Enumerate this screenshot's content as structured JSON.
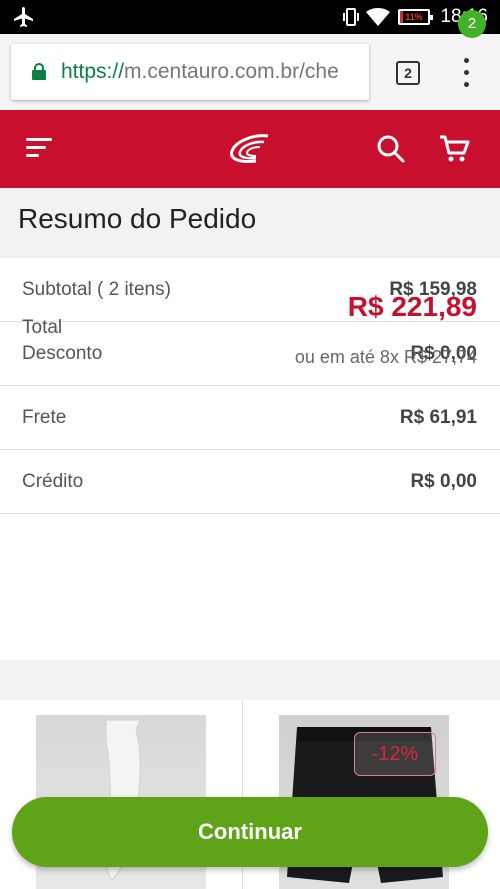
{
  "status_bar": {
    "time": "18:16",
    "battery_text": "11%",
    "battery_level": 0.11,
    "icons": [
      "airplane-icon",
      "vibrate-icon",
      "wifi-icon",
      "battery-icon"
    ]
  },
  "browser": {
    "url_scheme": "https://",
    "url_rest": "m.centauro.com.br/che",
    "tab_count": "2",
    "colors": {
      "secure": "#0b8043"
    }
  },
  "header": {
    "cart_count": "2",
    "colors": {
      "brand": "#c8102e",
      "badge": "#43b02a"
    },
    "icons": [
      "menu-icon",
      "centauro-logo",
      "search-icon",
      "cart-icon"
    ]
  },
  "summary": {
    "title": "Resumo do Pedido",
    "rows": [
      {
        "label": "Subtotal ( 2 itens)",
        "value": "R$ 159,98"
      },
      {
        "label": "Desconto",
        "value": "R$ 0,00"
      },
      {
        "label": "Frete",
        "value": "R$ 61,91"
      },
      {
        "label": "Crédito",
        "value": "R$ 0,00"
      }
    ],
    "total": {
      "label": "Total",
      "value": "R$ 221,89",
      "installments": "ou em até  8x R$ 27,74"
    }
  },
  "products": {
    "discount_badge": "-12%"
  },
  "actions": {
    "continue_label": "Continuar",
    "colors": {
      "primary": "#5fa318"
    }
  }
}
